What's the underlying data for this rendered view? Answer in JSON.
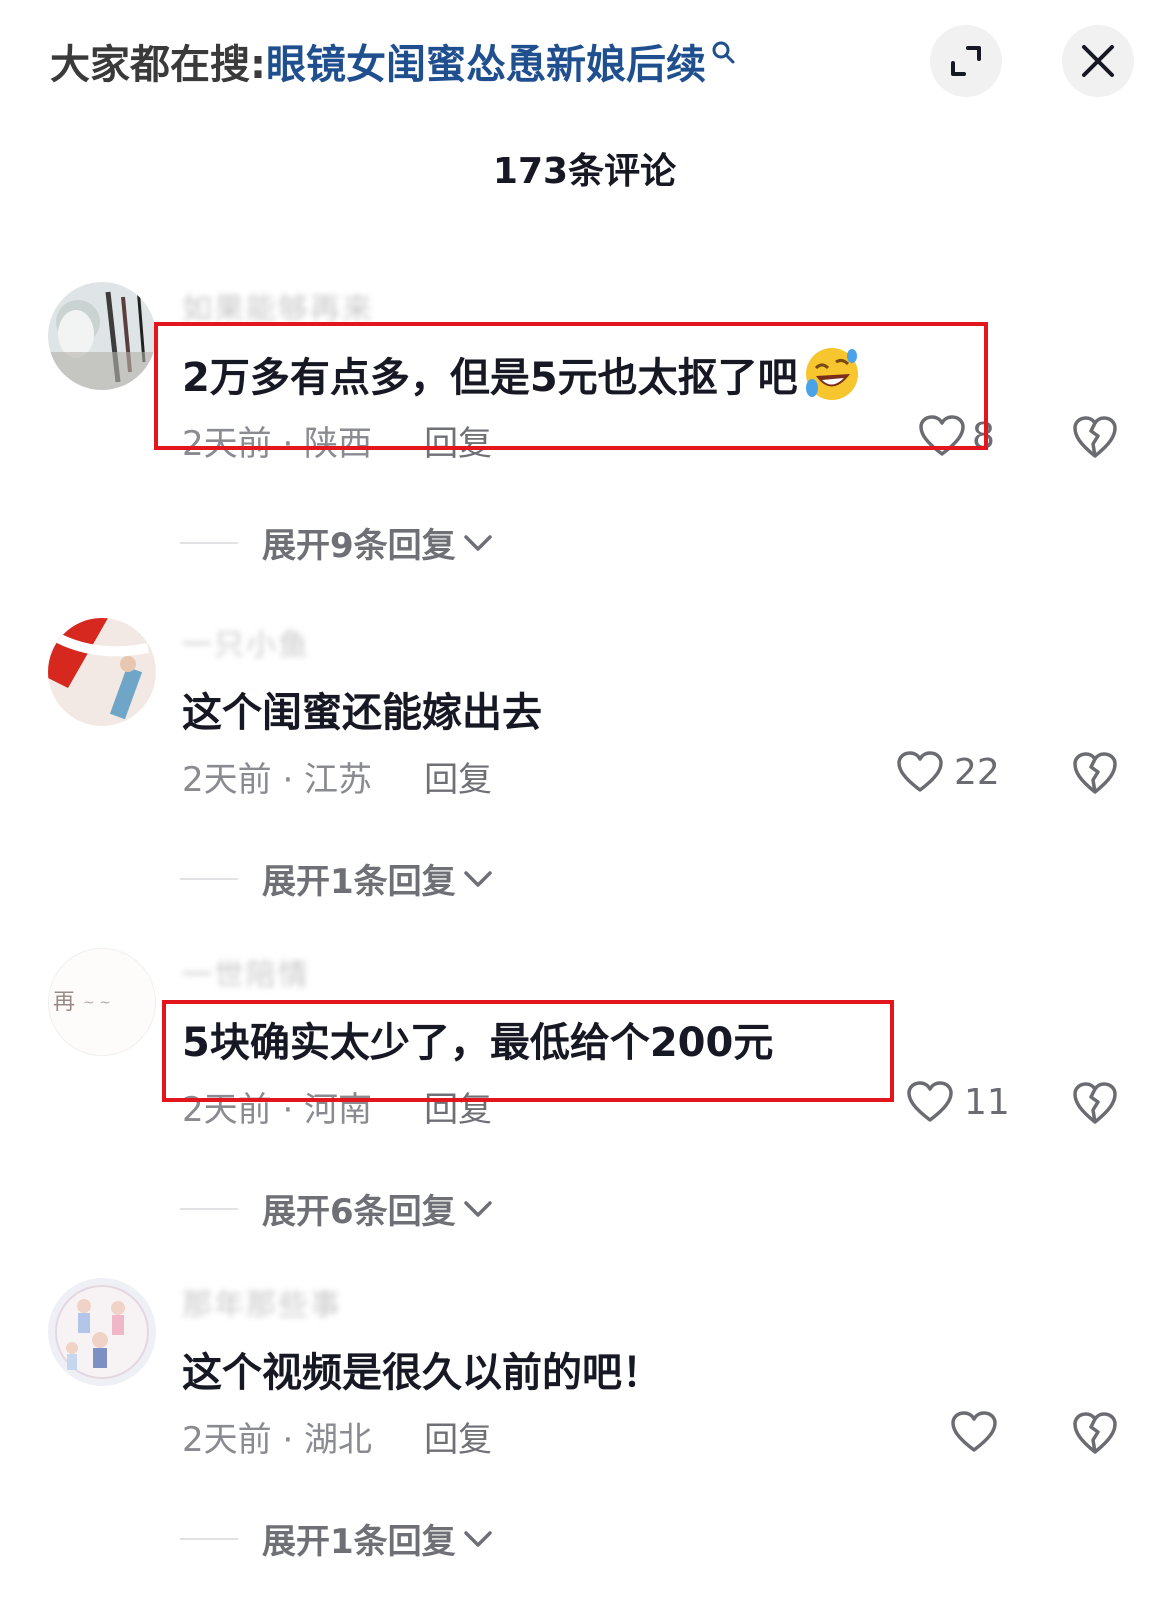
{
  "header": {
    "search_prefix": "大家都在搜:",
    "search_query": "眼镜女闺蜜怂恿新娘后续",
    "comment_count": "173条评论"
  },
  "comments": [
    {
      "username": "如果能够再来",
      "text": "2万多有点多，但是5元也太抠了吧",
      "emoji": "rofl-emoji",
      "time": "2天前 · 陕西",
      "reply": "回复",
      "likes": "8",
      "expand": "展开9条回复",
      "highlighted": true
    },
    {
      "username": "一只小鱼",
      "text": "这个闺蜜还能嫁出去",
      "time": "2天前 · 江苏",
      "reply": "回复",
      "likes": "22",
      "expand": "展开1条回复",
      "highlighted": false
    },
    {
      "username": "一世陪情",
      "text": "5块确实太少了，最低给个200元",
      "time": "2天前 · 河南",
      "reply": "回复",
      "likes": "11",
      "expand": "展开6条回复",
      "highlighted": true
    },
    {
      "username": "那年那些事",
      "text": "这个视频是很久以前的吧！",
      "time": "2天前 · 湖北",
      "reply": "回复",
      "likes": "",
      "expand": "展开1条回复",
      "highlighted": false
    }
  ],
  "colors": {
    "highlight_box": "#e3161e",
    "search_query": "#1f4f8f"
  }
}
